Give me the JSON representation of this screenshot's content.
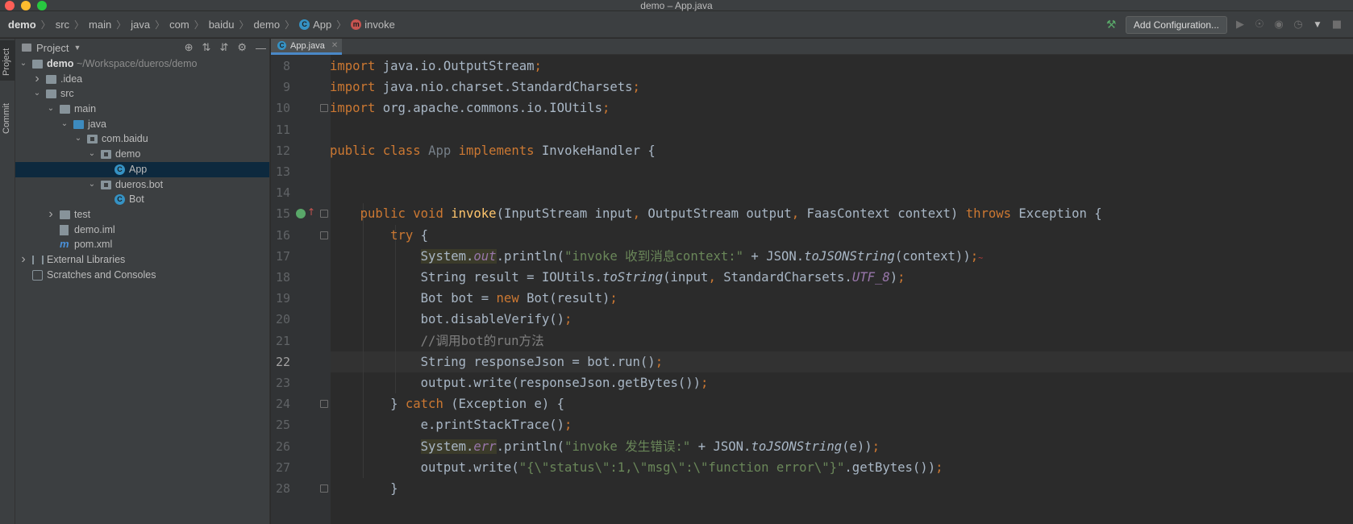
{
  "window": {
    "title": "demo – App.java"
  },
  "traffic_lights": {
    "close": "#ff5f57",
    "minimize": "#febc2e",
    "zoom": "#28c840"
  },
  "breadcrumbs": [
    {
      "label": "demo",
      "icon": null
    },
    {
      "label": "src",
      "icon": null
    },
    {
      "label": "main",
      "icon": null
    },
    {
      "label": "java",
      "icon": null
    },
    {
      "label": "com",
      "icon": null
    },
    {
      "label": "baidu",
      "icon": null
    },
    {
      "label": "demo",
      "icon": null
    },
    {
      "label": "App",
      "icon": "class-icon",
      "icon_letter": "C"
    },
    {
      "label": "invoke",
      "icon": "method-icon",
      "icon_letter": "m"
    }
  ],
  "toolbar": {
    "build_icon": "hammer-icon",
    "add_config_label": "Add Configuration...",
    "icons": [
      "run-icon",
      "debug-icon",
      "coverage-icon",
      "profile-icon",
      "dropdown-icon",
      "stop-icon"
    ]
  },
  "side_tabs": {
    "project": "Project",
    "commit": "Commit"
  },
  "project_panel": {
    "title": "Project",
    "tools": [
      "locate-icon",
      "expand-all-icon",
      "collapse-all-icon",
      "gear-icon",
      "minimize-icon"
    ],
    "tree": [
      {
        "label": "demo",
        "suffix": "~/Workspace/dueros/demo",
        "arrow": "down",
        "icon": "module-folder",
        "indent": 0,
        "bold": true
      },
      {
        "label": ".idea",
        "arrow": "right",
        "icon": "folder",
        "indent": 1
      },
      {
        "label": "src",
        "arrow": "down",
        "icon": "folder",
        "indent": 1
      },
      {
        "label": "main",
        "arrow": "down",
        "icon": "folder",
        "indent": 2
      },
      {
        "label": "java",
        "arrow": "down",
        "icon": "source-folder",
        "indent": 3
      },
      {
        "label": "com.baidu",
        "arrow": "down",
        "icon": "package",
        "indent": 4
      },
      {
        "label": "demo",
        "arrow": "down",
        "icon": "package",
        "indent": 5
      },
      {
        "label": "App",
        "arrow": "none",
        "icon": "class",
        "indent": 6,
        "selected": true
      },
      {
        "label": "dueros.bot",
        "arrow": "down",
        "icon": "package",
        "indent": 5
      },
      {
        "label": "Bot",
        "arrow": "none",
        "icon": "class",
        "indent": 6
      },
      {
        "label": "test",
        "arrow": "right",
        "icon": "folder",
        "indent": 2
      },
      {
        "label": "demo.iml",
        "arrow": "none",
        "icon": "iml-file",
        "indent": 2
      },
      {
        "label": "pom.xml",
        "arrow": "none",
        "icon": "maven-file",
        "indent": 2
      },
      {
        "label": "External Libraries",
        "arrow": "right",
        "icon": "library",
        "indent": 0
      },
      {
        "label": "Scratches and Consoles",
        "arrow": "none",
        "icon": "scratches",
        "indent": 0
      }
    ]
  },
  "editor": {
    "tab": {
      "label": "App.java",
      "icon": "class-icon"
    },
    "current_line": 22,
    "lines": [
      {
        "n": "8",
        "tokens": [
          [
            "kw",
            "import"
          ],
          [
            "t",
            " java.io.OutputStream"
          ],
          [
            "kw",
            ";"
          ]
        ]
      },
      {
        "n": "9",
        "tokens": [
          [
            "kw",
            "import"
          ],
          [
            "t",
            " java.nio.charset.StandardCharsets"
          ],
          [
            "kw",
            ";"
          ]
        ]
      },
      {
        "n": "10",
        "tokens": [
          [
            "kw",
            "import"
          ],
          [
            "t",
            " org.apache.commons.io.IOUtils"
          ],
          [
            "kw",
            ";"
          ]
        ]
      },
      {
        "n": "11",
        "tokens": []
      },
      {
        "n": "12",
        "tokens": [
          [
            "kw",
            "public class "
          ],
          [
            "dim",
            "App"
          ],
          [
            "kw",
            " implements "
          ],
          [
            "t",
            "InvokeHandler {"
          ]
        ]
      },
      {
        "n": "13",
        "tokens": []
      },
      {
        "n": "14",
        "tokens": []
      },
      {
        "n": "15",
        "tokens": [
          [
            "t",
            "    "
          ],
          [
            "kw",
            "public void "
          ],
          [
            "fn",
            "invoke"
          ],
          [
            "t",
            "(InputStream input"
          ],
          [
            "kw",
            ", "
          ],
          [
            "t",
            "OutputStream output"
          ],
          [
            "kw",
            ", "
          ],
          [
            "t",
            "FaasContext context) "
          ],
          [
            "kw",
            "throws "
          ],
          [
            "t",
            "Exception {"
          ]
        ]
      },
      {
        "n": "16",
        "tokens": [
          [
            "t",
            "        "
          ],
          [
            "kw",
            "try "
          ],
          [
            "t",
            "{"
          ]
        ]
      },
      {
        "n": "17",
        "tokens": [
          [
            "t",
            "            "
          ],
          [
            "hl",
            "System."
          ],
          [
            "hlst",
            "out"
          ],
          [
            "t",
            ".println("
          ],
          [
            "str",
            "\"invoke 收到消息context:\""
          ],
          [
            "t",
            " + JSON."
          ],
          [
            "it",
            "toJSONString"
          ],
          [
            "t",
            "(context))"
          ],
          [
            "kw",
            ";"
          ]
        ]
      },
      {
        "n": "18",
        "tokens": [
          [
            "t",
            "            String result = IOUtils."
          ],
          [
            "it",
            "toString"
          ],
          [
            "t",
            "(input"
          ],
          [
            "kw",
            ", "
          ],
          [
            "t",
            "StandardCharsets."
          ],
          [
            "st",
            "UTF_8"
          ],
          [
            "t",
            ")"
          ],
          [
            "kw",
            ";"
          ]
        ]
      },
      {
        "n": "19",
        "tokens": [
          [
            "t",
            "            Bot bot = "
          ],
          [
            "kw",
            "new "
          ],
          [
            "t",
            "Bot(result)"
          ],
          [
            "kw",
            ";"
          ]
        ]
      },
      {
        "n": "20",
        "tokens": [
          [
            "t",
            "            bot.disableVerify()"
          ],
          [
            "kw",
            ";"
          ]
        ]
      },
      {
        "n": "21",
        "tokens": [
          [
            "t",
            "            "
          ],
          [
            "cm",
            "//调用bot的run方法"
          ]
        ]
      },
      {
        "n": "22",
        "tokens": [
          [
            "t",
            "            String responseJson = bot.run()"
          ],
          [
            "kw",
            ";"
          ]
        ]
      },
      {
        "n": "23",
        "tokens": [
          [
            "t",
            "            output.write(responseJson.getBytes())"
          ],
          [
            "kw",
            ";"
          ]
        ]
      },
      {
        "n": "24",
        "tokens": [
          [
            "t",
            "        } "
          ],
          [
            "kw",
            "catch "
          ],
          [
            "t",
            "(Exception e) {"
          ]
        ]
      },
      {
        "n": "25",
        "tokens": [
          [
            "t",
            "            e.printStackTrace()"
          ],
          [
            "kw",
            ";"
          ]
        ]
      },
      {
        "n": "26",
        "tokens": [
          [
            "t",
            "            "
          ],
          [
            "hl",
            "System."
          ],
          [
            "hlst",
            "err"
          ],
          [
            "t",
            ".println("
          ],
          [
            "str",
            "\"invoke 发生错误:\""
          ],
          [
            "t",
            " + JSON."
          ],
          [
            "it",
            "toJSONString"
          ],
          [
            "t",
            "(e))"
          ],
          [
            "kw",
            ";"
          ]
        ]
      },
      {
        "n": "27",
        "tokens": [
          [
            "t",
            "            output.write("
          ],
          [
            "str",
            "\"{\\\"status\\\":1,\\\"msg\\\":\\\"function error\\\"}\""
          ],
          [
            "t",
            ".getBytes())"
          ],
          [
            "kw",
            ";"
          ]
        ]
      },
      {
        "n": "28",
        "tokens": [
          [
            "t",
            "        }"
          ]
        ]
      }
    ]
  }
}
